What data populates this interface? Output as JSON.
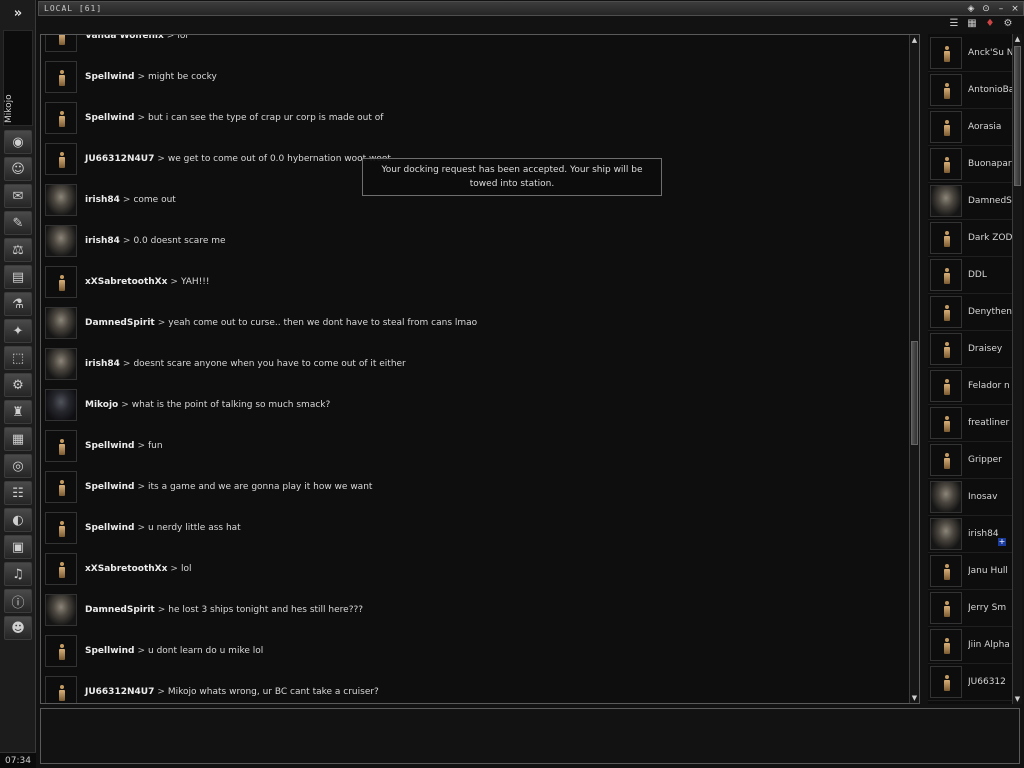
{
  "neocom": {
    "expand_glyph": "»",
    "character_name": "Mikojo",
    "clock": "07:34",
    "buttons": [
      "character-sheet-icon",
      "people-places-icon",
      "mail-icon",
      "notepad-icon",
      "market-icon",
      "contracts-icon",
      "science-industry-icon",
      "map-icon",
      "assets-icon",
      "fitting-icon",
      "corporation-icon",
      "wallet-icon",
      "help-icon",
      "channels-icon",
      "browser-icon",
      "journal-icon",
      "music-icon",
      "info-icon",
      "logout-icon"
    ]
  },
  "window": {
    "title": "LOCAL [61]",
    "controls": [
      "pin-icon",
      "options-icon",
      "minimize-icon",
      "close-icon"
    ],
    "toolbar": [
      "list-view-icon",
      "detail-view-icon",
      "sort-icon",
      "settings-icon"
    ]
  },
  "notice": {
    "line1": "Your docking request has been accepted. Your ship will be",
    "line2": "towed into station."
  },
  "messages": [
    {
      "author": "Vanda Wolfenix",
      "text": "lol",
      "portrait": "silhouette"
    },
    {
      "author": "Spellwind",
      "text": "might be cocky",
      "portrait": "silhouette"
    },
    {
      "author": "Spellwind",
      "text": "but i can see the type of crap ur corp is made out of",
      "portrait": "silhouette"
    },
    {
      "author": "JU66312N4U7",
      "text": "we get to come out of 0.0 hybernation woot woot",
      "portrait": "silhouette"
    },
    {
      "author": "irish84",
      "text": "come out",
      "portrait": "face"
    },
    {
      "author": "irish84",
      "text": "0.0 doesnt scare me",
      "portrait": "face"
    },
    {
      "author": "xXSabretoothXx",
      "text": "YAH!!!",
      "portrait": "silhouette"
    },
    {
      "author": "DamnedSpirit",
      "text": "yeah come out to curse.. then we dont have to steal from cans lmao",
      "portrait": "face"
    },
    {
      "author": "irish84",
      "text": "doesnt scare anyone when you have to come out of it either",
      "portrait": "face"
    },
    {
      "author": "Mikojo",
      "text": "what is the point of talking so much smack?",
      "portrait": "dark"
    },
    {
      "author": "Spellwind",
      "text": "fun",
      "portrait": "silhouette"
    },
    {
      "author": "Spellwind",
      "text": "its a game and we are gonna play it how we want",
      "portrait": "silhouette"
    },
    {
      "author": "Spellwind",
      "text": "u nerdy little ass hat",
      "portrait": "silhouette"
    },
    {
      "author": "xXSabretoothXx",
      "text": "lol",
      "portrait": "silhouette"
    },
    {
      "author": "DamnedSpirit",
      "text": "he lost 3 ships tonight and hes still here???",
      "portrait": "face"
    },
    {
      "author": "Spellwind",
      "text": "u dont learn do u mike lol",
      "portrait": "silhouette"
    },
    {
      "author": "JU66312N4U7",
      "text": "Mikojo whats wrong, ur BC cant take a cruiser?",
      "portrait": "silhouette"
    }
  ],
  "members": [
    {
      "name": "Anck'Su N",
      "portrait": "silhouette"
    },
    {
      "name": "AntonioBa",
      "portrait": "silhouette"
    },
    {
      "name": "Aorasia",
      "portrait": "silhouette"
    },
    {
      "name": "Buonapart",
      "portrait": "silhouette"
    },
    {
      "name": "DamnedSp",
      "portrait": "face"
    },
    {
      "name": "Dark ZOD",
      "portrait": "silhouette"
    },
    {
      "name": "DDL",
      "portrait": "silhouette"
    },
    {
      "name": "Denythen",
      "portrait": "silhouette"
    },
    {
      "name": "Draisey",
      "portrait": "silhouette"
    },
    {
      "name": "Felador n",
      "portrait": "silhouette"
    },
    {
      "name": "freatliner",
      "portrait": "silhouette"
    },
    {
      "name": "Gripper",
      "portrait": "silhouette"
    },
    {
      "name": "Inosav",
      "portrait": "face"
    },
    {
      "name": "irish84",
      "portrait": "face",
      "badge": "+"
    },
    {
      "name": "Janu Hull",
      "portrait": "silhouette"
    },
    {
      "name": "Jerry Sm",
      "portrait": "silhouette"
    },
    {
      "name": "Jiin Alpha",
      "portrait": "silhouette"
    },
    {
      "name": "JU66312",
      "portrait": "silhouette"
    }
  ],
  "scroll": {
    "up_glyph": "▲",
    "down_glyph": "▼"
  }
}
